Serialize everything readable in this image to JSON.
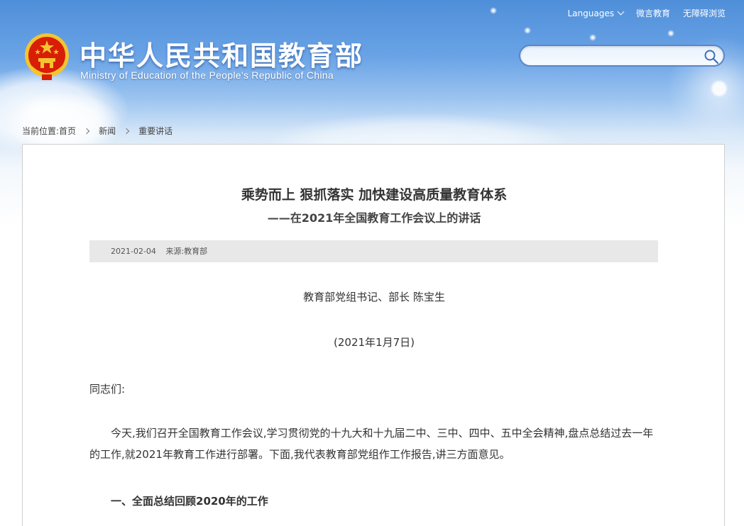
{
  "header": {
    "top_links": [
      "Languages",
      "微言教育",
      "无障碍浏览"
    ],
    "site_title": "中华人民共和国教育部",
    "site_subtitle": "Ministry of Education of the People's Republic of China",
    "search": {
      "value": "",
      "placeholder": ""
    },
    "icons": {
      "emblem": "national-emblem-icon",
      "search": "search-icon",
      "languages_dropdown": "chevron-down-icon"
    }
  },
  "breadcrumb": {
    "label": "当前位置:",
    "items": [
      "首页",
      "新闻",
      "重要讲话"
    ]
  },
  "article": {
    "title": "乘势而上 狠抓落实 加快建设高质量教育体系",
    "subtitle": "——在2021年全国教育工作会议上的讲话",
    "date": "2021-02-04",
    "source": "来源:教育部",
    "speaker": "教育部党组书记、部长 陈宝生",
    "speech_date": "(2021年1月7日)",
    "salutation": "同志们:",
    "paragraph_1": "今天,我们召开全国教育工作会议,学习贯彻党的十九大和十九届二中、三中、四中、五中全会精神,盘点总结过去一年的工作,就2021年教育工作进行部署。下面,我代表教育部党组作工作报告,讲三方面意见。",
    "section_1_heading": "一、全面总结回顾2020年的工作"
  },
  "colors": {
    "sky_top": "#4f8fd9",
    "title_text": "#ffffff",
    "emblem_red": "#d81e06",
    "emblem_gold": "#f4c430",
    "meta_bar": "#e8e8e8",
    "search_border": "#5b86c8"
  }
}
